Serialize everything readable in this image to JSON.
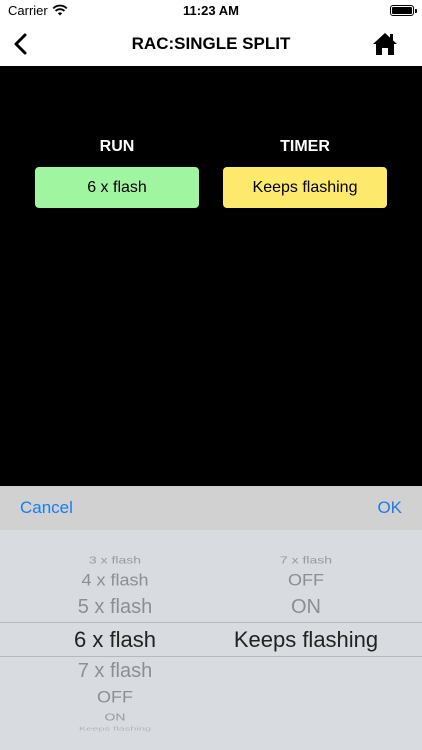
{
  "status_bar": {
    "carrier": "Carrier",
    "time": "11:23 AM"
  },
  "nav": {
    "title": "RAC:SINGLE SPLIT"
  },
  "main": {
    "run_label": "RUN",
    "run_value": "6 x flash",
    "timer_label": "TIMER",
    "timer_value": "Keeps flashing",
    "colors": {
      "run_box": "#a0f5a0",
      "timer_box": "#fde96b"
    }
  },
  "picker_toolbar": {
    "cancel_label": "Cancel",
    "ok_label": "OK"
  },
  "picker": {
    "left_options": [
      "3 x flash",
      "4 x flash",
      "5 x flash",
      "6 x flash",
      "7 x flash",
      "OFF",
      "ON",
      "Keeps flashing"
    ],
    "left_selected": "6 x flash",
    "right_options": [
      "7 x flash",
      "OFF",
      "ON",
      "Keeps flashing"
    ],
    "right_selected": "Keeps flashing"
  }
}
